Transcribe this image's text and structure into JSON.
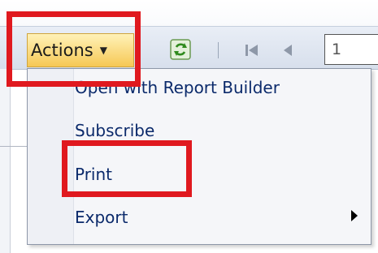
{
  "toolbar": {
    "actions_label": "Actions",
    "page_number_value": "1"
  },
  "menu": {
    "items": [
      {
        "label": "Open with Report Builder"
      },
      {
        "label": "Subscribe"
      },
      {
        "label": "Print"
      },
      {
        "label": "Export",
        "has_submenu": true
      }
    ]
  },
  "highlight_color": "#e0191f",
  "icons": [
    "chevron-down-icon",
    "refresh-icon",
    "first-page-icon",
    "previous-page-icon",
    "submenu-arrow-icon"
  ]
}
